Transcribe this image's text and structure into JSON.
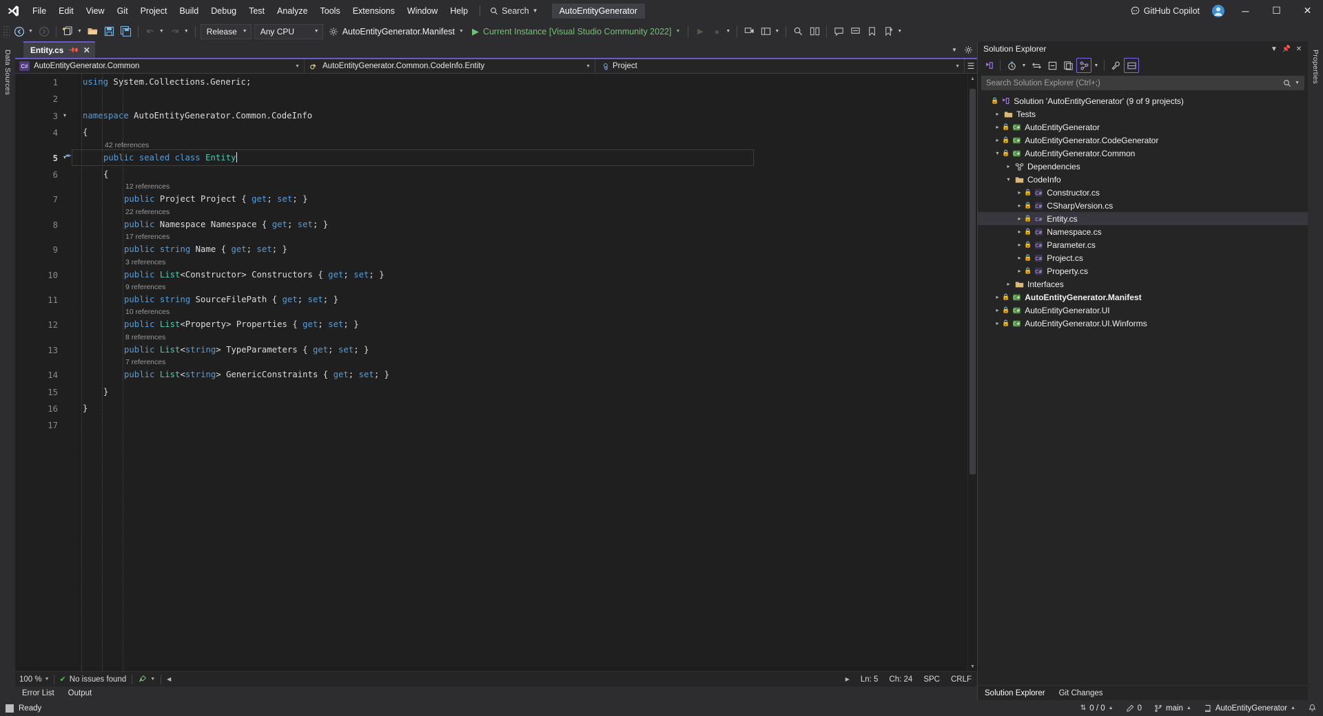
{
  "titlebar": {
    "logo": "visual-studio-logo",
    "menus": [
      "File",
      "Edit",
      "View",
      "Git",
      "Project",
      "Build",
      "Debug",
      "Test",
      "Analyze",
      "Tools",
      "Extensions",
      "Window",
      "Help"
    ],
    "search_label": "Search",
    "project_chip": "AutoEntityGenerator",
    "copilot_label": "GitHub Copilot",
    "minimize": "─",
    "maximize": "☐",
    "close": "✕"
  },
  "toolbar": {
    "back_label": "←",
    "forward_label": "→",
    "configuration": "Release",
    "platform": "Any CPU",
    "startup_project": "AutoEntityGenerator.Manifest",
    "run_target": "Current Instance [Visual Studio Community 2022]"
  },
  "left_dock": {
    "tabs": [
      "Data Sources"
    ]
  },
  "right_dock": {
    "tabs": [
      "Properties"
    ]
  },
  "editor": {
    "tab_name": "Entity.cs",
    "pin_icon": "pin-icon",
    "close_icon": "close-icon",
    "nav_project": "AutoEntityGenerator.Common",
    "nav_type": "AutoEntityGenerator.Common.CodeInfo.Entity",
    "nav_member": "Project",
    "line_numbers": [
      "1",
      "2",
      "3",
      "4",
      "5",
      "6",
      "7",
      "8",
      "9",
      "10",
      "11",
      "12",
      "13",
      "14",
      "15",
      "16",
      "17"
    ],
    "current_line": "5",
    "lines": [
      {
        "n": 1,
        "ref": null,
        "fold": null,
        "indent": 0,
        "tokens": [
          {
            "t": "using",
            "c": "kw"
          },
          {
            "t": " System",
            "c": "plain"
          },
          {
            "t": ".",
            "c": "punc"
          },
          {
            "t": "Collections",
            "c": "plain"
          },
          {
            "t": ".",
            "c": "punc"
          },
          {
            "t": "Generic",
            "c": "plain"
          },
          {
            "t": ";",
            "c": "punc"
          }
        ]
      },
      {
        "n": 2,
        "ref": null,
        "fold": null,
        "indent": 0,
        "tokens": []
      },
      {
        "n": 3,
        "ref": null,
        "fold": "open",
        "indent": 0,
        "tokens": [
          {
            "t": "namespace",
            "c": "kw"
          },
          {
            "t": " AutoEntityGenerator",
            "c": "plain"
          },
          {
            "t": ".",
            "c": "punc"
          },
          {
            "t": "Common",
            "c": "plain"
          },
          {
            "t": ".",
            "c": "punc"
          },
          {
            "t": "CodeInfo",
            "c": "plain"
          }
        ]
      },
      {
        "n": 4,
        "ref": null,
        "fold": null,
        "indent": 0,
        "tokens": [
          {
            "t": "{",
            "c": "punc"
          }
        ]
      },
      {
        "n": 5,
        "ref": "42 references",
        "fold": "open",
        "indent": 1,
        "tokens": [
          {
            "t": "public",
            "c": "kw"
          },
          {
            "t": " ",
            "c": "plain"
          },
          {
            "t": "sealed",
            "c": "kw"
          },
          {
            "t": " ",
            "c": "plain"
          },
          {
            "t": "class",
            "c": "kw"
          },
          {
            "t": " ",
            "c": "plain"
          },
          {
            "t": "Entity",
            "c": "type"
          }
        ]
      },
      {
        "n": 6,
        "ref": null,
        "fold": null,
        "indent": 1,
        "tokens": [
          {
            "t": "{",
            "c": "punc"
          }
        ]
      },
      {
        "n": 7,
        "ref": "12 references",
        "fold": null,
        "indent": 2,
        "tokens": [
          {
            "t": "public",
            "c": "kw"
          },
          {
            "t": " ",
            "c": "plain"
          },
          {
            "t": "Project",
            "c": "plain"
          },
          {
            "t": " Project ",
            "c": "plain"
          },
          {
            "t": "{ ",
            "c": "punc"
          },
          {
            "t": "get",
            "c": "kw"
          },
          {
            "t": "; ",
            "c": "punc"
          },
          {
            "t": "set",
            "c": "kw"
          },
          {
            "t": "; }",
            "c": "punc"
          }
        ]
      },
      {
        "n": 8,
        "ref": "22 references",
        "fold": null,
        "indent": 2,
        "tokens": [
          {
            "t": "public",
            "c": "kw"
          },
          {
            "t": " ",
            "c": "plain"
          },
          {
            "t": "Namespace",
            "c": "plain"
          },
          {
            "t": " Namespace ",
            "c": "plain"
          },
          {
            "t": "{ ",
            "c": "punc"
          },
          {
            "t": "get",
            "c": "kw"
          },
          {
            "t": "; ",
            "c": "punc"
          },
          {
            "t": "set",
            "c": "kw"
          },
          {
            "t": "; }",
            "c": "punc"
          }
        ]
      },
      {
        "n": 9,
        "ref": "17 references",
        "fold": null,
        "indent": 2,
        "tokens": [
          {
            "t": "public",
            "c": "kw"
          },
          {
            "t": " ",
            "c": "plain"
          },
          {
            "t": "string",
            "c": "kw"
          },
          {
            "t": " Name ",
            "c": "plain"
          },
          {
            "t": "{ ",
            "c": "punc"
          },
          {
            "t": "get",
            "c": "kw"
          },
          {
            "t": "; ",
            "c": "punc"
          },
          {
            "t": "set",
            "c": "kw"
          },
          {
            "t": "; }",
            "c": "punc"
          }
        ]
      },
      {
        "n": 10,
        "ref": "3 references",
        "fold": null,
        "indent": 2,
        "tokens": [
          {
            "t": "public",
            "c": "kw"
          },
          {
            "t": " ",
            "c": "plain"
          },
          {
            "t": "List",
            "c": "type"
          },
          {
            "t": "<",
            "c": "punc"
          },
          {
            "t": "Constructor",
            "c": "plain"
          },
          {
            "t": "> Constructors ",
            "c": "plain"
          },
          {
            "t": "{ ",
            "c": "punc"
          },
          {
            "t": "get",
            "c": "kw"
          },
          {
            "t": "; ",
            "c": "punc"
          },
          {
            "t": "set",
            "c": "kw"
          },
          {
            "t": "; }",
            "c": "punc"
          }
        ]
      },
      {
        "n": 11,
        "ref": "9 references",
        "fold": null,
        "indent": 2,
        "tokens": [
          {
            "t": "public",
            "c": "kw"
          },
          {
            "t": " ",
            "c": "plain"
          },
          {
            "t": "string",
            "c": "kw"
          },
          {
            "t": " SourceFilePath ",
            "c": "plain"
          },
          {
            "t": "{ ",
            "c": "punc"
          },
          {
            "t": "get",
            "c": "kw"
          },
          {
            "t": "; ",
            "c": "punc"
          },
          {
            "t": "set",
            "c": "kw"
          },
          {
            "t": "; }",
            "c": "punc"
          }
        ]
      },
      {
        "n": 12,
        "ref": "10 references",
        "fold": null,
        "indent": 2,
        "tokens": [
          {
            "t": "public",
            "c": "kw"
          },
          {
            "t": " ",
            "c": "plain"
          },
          {
            "t": "List",
            "c": "type"
          },
          {
            "t": "<",
            "c": "punc"
          },
          {
            "t": "Property",
            "c": "plain"
          },
          {
            "t": "> Properties ",
            "c": "plain"
          },
          {
            "t": "{ ",
            "c": "punc"
          },
          {
            "t": "get",
            "c": "kw"
          },
          {
            "t": "; ",
            "c": "punc"
          },
          {
            "t": "set",
            "c": "kw"
          },
          {
            "t": "; }",
            "c": "punc"
          }
        ]
      },
      {
        "n": 13,
        "ref": "8 references",
        "fold": null,
        "indent": 2,
        "tokens": [
          {
            "t": "public",
            "c": "kw"
          },
          {
            "t": " ",
            "c": "plain"
          },
          {
            "t": "List",
            "c": "type"
          },
          {
            "t": "<",
            "c": "punc"
          },
          {
            "t": "string",
            "c": "kw"
          },
          {
            "t": "> TypeParameters ",
            "c": "plain"
          },
          {
            "t": "{ ",
            "c": "punc"
          },
          {
            "t": "get",
            "c": "kw"
          },
          {
            "t": "; ",
            "c": "punc"
          },
          {
            "t": "set",
            "c": "kw"
          },
          {
            "t": "; }",
            "c": "punc"
          }
        ]
      },
      {
        "n": 14,
        "ref": "7 references",
        "fold": null,
        "indent": 2,
        "tokens": [
          {
            "t": "public",
            "c": "kw"
          },
          {
            "t": " ",
            "c": "plain"
          },
          {
            "t": "List",
            "c": "type"
          },
          {
            "t": "<",
            "c": "punc"
          },
          {
            "t": "string",
            "c": "kw"
          },
          {
            "t": "> GenericConstraints ",
            "c": "plain"
          },
          {
            "t": "{ ",
            "c": "punc"
          },
          {
            "t": "get",
            "c": "kw"
          },
          {
            "t": "; ",
            "c": "punc"
          },
          {
            "t": "set",
            "c": "kw"
          },
          {
            "t": "; }",
            "c": "punc"
          }
        ]
      },
      {
        "n": 15,
        "ref": null,
        "fold": null,
        "indent": 1,
        "tokens": [
          {
            "t": "}",
            "c": "punc"
          }
        ]
      },
      {
        "n": 16,
        "ref": null,
        "fold": null,
        "indent": 0,
        "tokens": [
          {
            "t": "}",
            "c": "punc"
          }
        ]
      },
      {
        "n": 17,
        "ref": null,
        "fold": null,
        "indent": 0,
        "tokens": []
      }
    ]
  },
  "editor_status": {
    "zoom": "100 %",
    "issues": "No issues found",
    "line": "Ln: 5",
    "col": "Ch: 24",
    "spaces": "SPC",
    "eol": "CRLF"
  },
  "bottom_tabs": [
    "Error List",
    "Output"
  ],
  "solution_explorer": {
    "title": "Solution Explorer",
    "search_placeholder": "Search Solution Explorer (Ctrl+;)",
    "tree": [
      {
        "depth": 0,
        "label": "Solution 'AutoEntityGenerator' (9 of 9 projects)",
        "icon": "solution-icon",
        "expand": "none",
        "lock": true,
        "bold": false,
        "selected": false
      },
      {
        "depth": 1,
        "label": "Tests",
        "icon": "folder-icon",
        "expand": "collapsed",
        "lock": false,
        "bold": false,
        "selected": false
      },
      {
        "depth": 1,
        "label": "AutoEntityGenerator",
        "icon": "project-icon",
        "expand": "collapsed",
        "lock": true,
        "bold": false,
        "selected": false
      },
      {
        "depth": 1,
        "label": "AutoEntityGenerator.CodeGenerator",
        "icon": "project-icon",
        "expand": "collapsed",
        "lock": true,
        "bold": false,
        "selected": false
      },
      {
        "depth": 1,
        "label": "AutoEntityGenerator.Common",
        "icon": "project-icon",
        "expand": "expanded",
        "lock": true,
        "bold": false,
        "selected": false
      },
      {
        "depth": 2,
        "label": "Dependencies",
        "icon": "dependencies-icon",
        "expand": "collapsed",
        "lock": false,
        "bold": false,
        "selected": false
      },
      {
        "depth": 2,
        "label": "CodeInfo",
        "icon": "folder-icon",
        "expand": "expanded",
        "lock": false,
        "bold": false,
        "selected": false
      },
      {
        "depth": 3,
        "label": "Constructor.cs",
        "icon": "csharp-icon",
        "expand": "collapsed",
        "lock": true,
        "bold": false,
        "selected": false
      },
      {
        "depth": 3,
        "label": "CSharpVersion.cs",
        "icon": "csharp-icon",
        "expand": "collapsed",
        "lock": true,
        "bold": false,
        "selected": false
      },
      {
        "depth": 3,
        "label": "Entity.cs",
        "icon": "csharp-icon",
        "expand": "collapsed",
        "lock": true,
        "bold": false,
        "selected": true
      },
      {
        "depth": 3,
        "label": "Namespace.cs",
        "icon": "csharp-icon",
        "expand": "collapsed",
        "lock": true,
        "bold": false,
        "selected": false
      },
      {
        "depth": 3,
        "label": "Parameter.cs",
        "icon": "csharp-icon",
        "expand": "collapsed",
        "lock": true,
        "bold": false,
        "selected": false
      },
      {
        "depth": 3,
        "label": "Project.cs",
        "icon": "csharp-icon",
        "expand": "collapsed",
        "lock": true,
        "bold": false,
        "selected": false
      },
      {
        "depth": 3,
        "label": "Property.cs",
        "icon": "csharp-icon",
        "expand": "collapsed",
        "lock": true,
        "bold": false,
        "selected": false
      },
      {
        "depth": 2,
        "label": "Interfaces",
        "icon": "folder-icon",
        "expand": "collapsed",
        "lock": false,
        "bold": false,
        "selected": false
      },
      {
        "depth": 1,
        "label": "AutoEntityGenerator.Manifest",
        "icon": "project-icon",
        "expand": "collapsed",
        "lock": true,
        "bold": true,
        "selected": false
      },
      {
        "depth": 1,
        "label": "AutoEntityGenerator.UI",
        "icon": "project-icon",
        "expand": "collapsed",
        "lock": true,
        "bold": false,
        "selected": false
      },
      {
        "depth": 1,
        "label": "AutoEntityGenerator.UI.Winforms",
        "icon": "project-icon",
        "expand": "collapsed",
        "lock": true,
        "bold": false,
        "selected": false
      }
    ],
    "bottom_tabs": [
      "Solution Explorer",
      "Git Changes"
    ]
  },
  "statusbar": {
    "ready": "Ready",
    "source_control_counts": "0 / 0",
    "pending_changes": "0",
    "branch": "main",
    "repo": "AutoEntityGenerator"
  },
  "colors": {
    "accent": "#6a5acd",
    "titlebar_bg": "#2d2d30",
    "editor_bg": "#1f1f1f",
    "panel_bg": "#252526",
    "keyword": "#569cd6",
    "type": "#4ec9b0",
    "reference_gray": "#9a9a9a",
    "run_green": "#6fc46f"
  }
}
